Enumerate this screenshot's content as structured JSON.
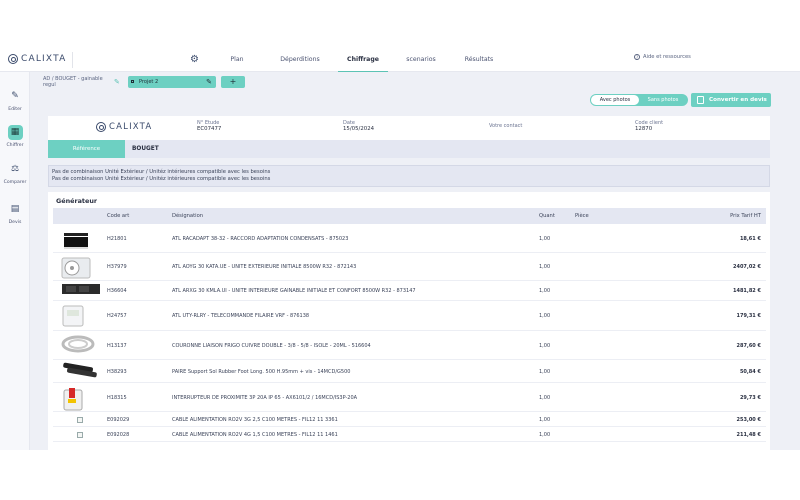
{
  "header": {
    "logo_text": "CALIXTA",
    "nav": [
      "Plan",
      "Déperditions",
      "Chiffrage",
      "scenarios",
      "Résultats"
    ],
    "active_nav": "Chiffrage",
    "help": "Aide et ressources"
  },
  "sidebar": {
    "items": [
      {
        "label": "Editer",
        "icon": "edit-icon"
      },
      {
        "label": "Chiffrer",
        "icon": "calculator-icon"
      },
      {
        "label": "Comparer",
        "icon": "compare-icon"
      },
      {
        "label": "Devis",
        "icon": "quote-icon"
      }
    ],
    "active": "Chiffrer"
  },
  "breadcrumb": "AD / BOUGET - gainable regul",
  "project_tab": "Projet 2",
  "add_tab": "+",
  "photo_toggle": {
    "with": "Avec photos",
    "without": "Sans photos",
    "selected": "Avec photos"
  },
  "convert_button": "Convertir en devis",
  "card": {
    "logo_text": "CALIXTA",
    "etude_label": "N° Etude",
    "etude_value": "EC07477",
    "date_label": "Date",
    "date_value": "15/05/2024",
    "contact_label": "Votre contact",
    "contact_value": "",
    "client_label": "Code client",
    "client_value": "12870",
    "tab_reference": "Référence",
    "tab_name": "BOUGET"
  },
  "messages": [
    "Pas de combinaison Unité Extérieur / Unitéz intérieures compatible avec les besoins",
    "Pas de combinaison Unité Extérieur / Unitéz intérieures compatible avec les besoins"
  ],
  "table": {
    "title": "Générateur",
    "headers": {
      "code": "Code art",
      "designation": "Désignation",
      "quantity": "Quant",
      "piece": "Pièce",
      "price": "Prix Tarif HT"
    },
    "rows": [
      {
        "code": "H21801",
        "designation": "ATL RACADAPT 38-32 - RACCORD ADAPTATION CONDENSATS - 875023",
        "quantity": "1,00",
        "price": "18,61 €",
        "thumb": "fitting"
      },
      {
        "code": "H37979",
        "designation": "ATL AOYG 30 KATA.UE - UNITE EXTERIEURE INITIALE 8500W R32 - 872143",
        "quantity": "1,00",
        "price": "2407,02 €",
        "thumb": "outdoor-unit"
      },
      {
        "code": "H36604",
        "designation": "ATL ARXG 30 KMLA.UI - UNITE INTERIEURE GAINABLE INITIALE ET CONFORT 8500W R32 - 873147",
        "quantity": "1,00",
        "price": "1481,82 €",
        "thumb": "duct-unit"
      },
      {
        "code": "H24757",
        "designation": "ATL UTY-RLRY - TELECOMMANDE FILAIRE VRF - 876138",
        "quantity": "1,00",
        "price": "179,31 €",
        "thumb": "remote"
      },
      {
        "code": "H13137",
        "designation": "COURONNE LIAISON FRIGO CUIVRE DOUBLE - 3/8 - 5/8 - ISOLE - 20ML - 516604",
        "quantity": "1,00",
        "price": "287,60 €",
        "thumb": "pipe-coil"
      },
      {
        "code": "H38293",
        "designation": "PAIRE Support Sol Rubber Foot Long. 500 H.95mm + vis - 14MCD/G500",
        "quantity": "1,00",
        "price": "50,84 €",
        "thumb": "rubber-feet"
      },
      {
        "code": "H18315",
        "designation": "INTERRUPTEUR DE PROXIMITE 3P 20A IP 65 - AX6101/2 / 16MCD/IS3P-20A",
        "quantity": "1,00",
        "price": "29,73 €",
        "thumb": "switch"
      },
      {
        "code": "E092029",
        "designation": "CABLE ALIMENTATION RO2V 3G 2,5 C100 METRES - FIL12 11 3361",
        "quantity": "1,00",
        "price": "253,00 €",
        "thumb": "broken"
      },
      {
        "code": "E092028",
        "designation": "CABLE ALIMENTATION RO2V 4G 1,5 C100 METRES - FIL12 11 1461",
        "quantity": "1,00",
        "price": "211,48 €",
        "thumb": "broken"
      }
    ]
  }
}
